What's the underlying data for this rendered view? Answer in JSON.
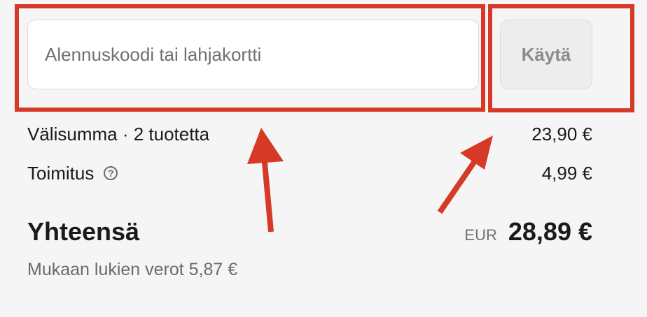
{
  "discount": {
    "placeholder": "Alennuskoodi tai lahjakortti",
    "value": "",
    "apply_label": "Käytä"
  },
  "summary": {
    "subtotal_label": "Välisumma · 2 tuotetta",
    "subtotal_value": "23,90 €",
    "shipping_label": "Toimitus",
    "shipping_help_icon": "question-circle-icon",
    "shipping_value": "4,99 €",
    "total_label": "Yhteensä",
    "currency_code": "EUR",
    "total_value": "28,89 €",
    "tax_note": "Mukaan lukien verot 5,87 €"
  },
  "annotations": {
    "highlight_color": "#d63a27",
    "page_background": "#f5f5f5"
  }
}
